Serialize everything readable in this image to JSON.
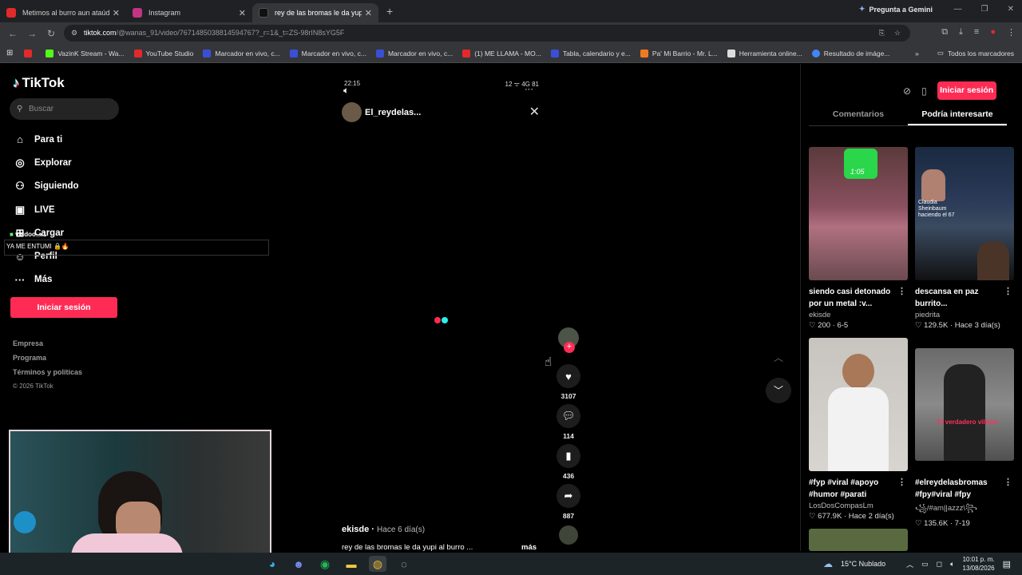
{
  "browser": {
    "tabs": [
      {
        "label": "Metimos al burro aun ataúd (B",
        "color": "#e22a2a"
      },
      {
        "label": "Instagram",
        "color": "#c13584"
      },
      {
        "label": "rey de las bromas le da yupi al",
        "color": "#111111"
      }
    ],
    "new_tab_label": "+",
    "gemini_label": "Pregunta a Gemini",
    "url_host": "tiktok.com",
    "url_path": "/@wanas_91/video/7671485038814594767?_r=1&_t=ZS-98rIN8sYG5F",
    "bookmarks": [
      {
        "label": "",
        "color": "#e22a2a"
      },
      {
        "label": "VazinK Stream - Wa...",
        "color": "#53fc18"
      },
      {
        "label": "YouTube Studio",
        "color": "#e22a2a"
      },
      {
        "label": "Marcador en vivo, c...",
        "color": "#3b4fd6"
      },
      {
        "label": "Marcador en vivo, c...",
        "color": "#3b4fd6"
      },
      {
        "label": "Marcador en vivo, c...",
        "color": "#3b4fd6"
      },
      {
        "label": "(1) ME LLAMA - MO...",
        "color": "#e22a2a"
      },
      {
        "label": "Tabla, calendario y e...",
        "color": "#3b4fd6"
      },
      {
        "label": "Pa' Mi Barrio - Mr. L...",
        "color": "#f07a20"
      },
      {
        "label": "Herramienta online...",
        "color": "#dddddd"
      },
      {
        "label": "Resultado de imáge...",
        "color": "#4285f4"
      }
    ],
    "all_bookmarks_label": "Todos los marcadores"
  },
  "sidebar": {
    "logo": "TikTok",
    "search_placeholder": "Buscar",
    "nav": [
      {
        "label": "Para ti",
        "icon": "⌂"
      },
      {
        "label": "Explorar",
        "icon": "◎"
      },
      {
        "label": "Siguiendo",
        "icon": "⚇"
      },
      {
        "label": "LIVE",
        "icon": "▣"
      },
      {
        "label": "Cargar",
        "icon": "⊞"
      },
      {
        "label": "Perfil",
        "icon": "☺"
      },
      {
        "label": "Más",
        "icon": "···"
      }
    ],
    "login_label": "Iniciar sesión",
    "footer": [
      "Empresa",
      "Programa",
      "Términos y políticas"
    ],
    "copyright": "© 2026 TikTok"
  },
  "overlay": {
    "username": "valdoo_x1",
    "message": "YA ME ENTUMI 🔒🔥"
  },
  "video": {
    "status_time": "22:15",
    "status_right": "12 ᯤ 4G 81",
    "username": "El_reydelas...",
    "author": "ekisde",
    "ago": "Hace 6 día(s)",
    "description": "rey de las bromas le da yupi al burro ...",
    "more_label": "más",
    "likes": "3107",
    "comments": "114",
    "saves": "436",
    "shares": "887"
  },
  "panel": {
    "login_label": "Iniciar sesión",
    "tabs": [
      "Comentarios",
      "Podría interesarte"
    ],
    "cards": [
      {
        "title": "siendo casi detonado por un metal :v...",
        "author": "ekisde",
        "likes": "200",
        "date": "6-5",
        "overlay": "1:05"
      },
      {
        "title": "descansa en paz burrito...",
        "author": "piedrita",
        "likes": "129.5K",
        "date": "Hace 3 día(s)",
        "overlay": "Claudia Sheinbaum haciendo el 67"
      },
      {
        "title": "#fyp #viral #apoyo #humor #parati",
        "author": "LosDosCompasLm",
        "likes": "677.9K",
        "date": "Hace 2 día(s)",
        "overlay": ""
      },
      {
        "title": "#elreydelasbromas #fpy#viral #fpy",
        "author": "꧁/#am||azzz\\꧂",
        "likes": "135.6K",
        "date": "7-19",
        "overlay": "El verdadero villano"
      }
    ]
  },
  "taskbar": {
    "weather": "15°C  Nublado",
    "time": "10:01 p. m.",
    "date": "13/08/2026"
  },
  "colors": {
    "accent": "#fe2c55",
    "cyan": "#25f4ee"
  }
}
